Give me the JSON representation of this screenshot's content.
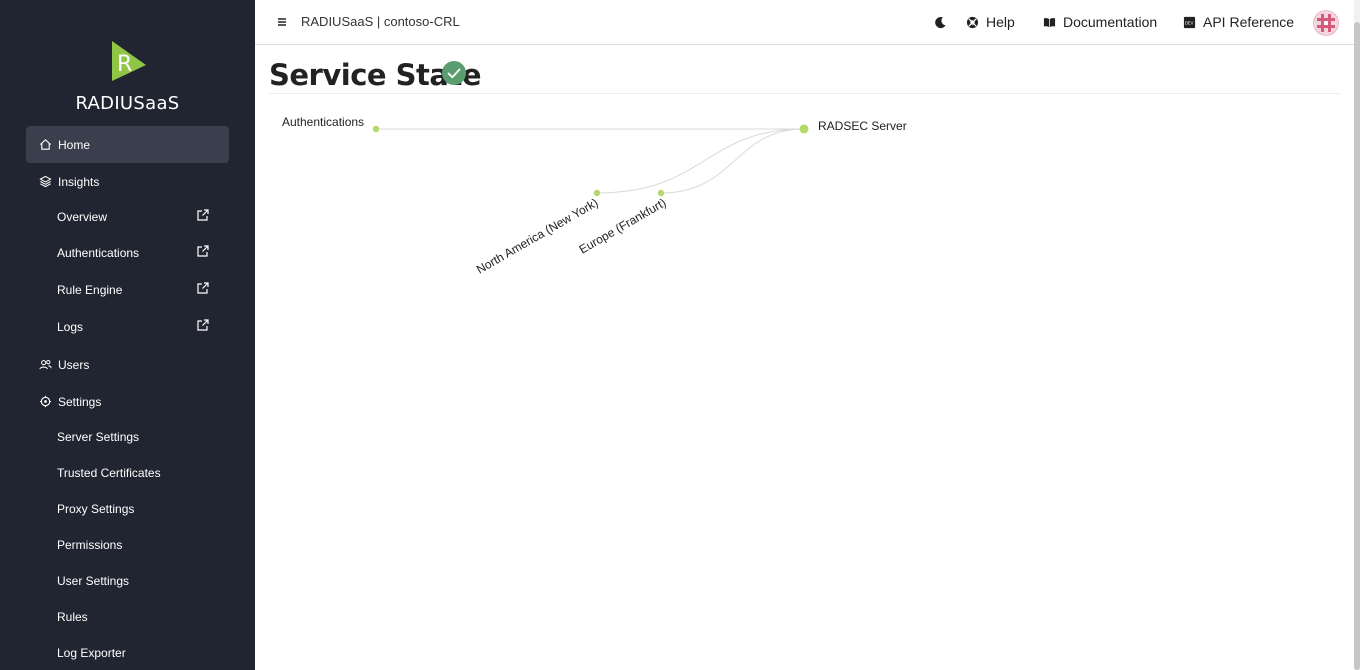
{
  "brand": {
    "name": "RADIUSaaS",
    "logo_letter": "R",
    "logo_color": "#8fc646"
  },
  "sidebar": {
    "home": {
      "label": "Home",
      "icon": "home-icon"
    },
    "insights": {
      "label": "Insights",
      "icon": "layers-icon",
      "items": [
        {
          "label": "Overview",
          "icon": "external-link-icon"
        },
        {
          "label": "Authentications",
          "icon": "external-link-icon"
        },
        {
          "label": "Rule Engine",
          "icon": "external-link-icon"
        },
        {
          "label": "Logs",
          "icon": "external-link-icon"
        }
      ]
    },
    "users": {
      "label": "Users",
      "icon": "users-icon"
    },
    "settings": {
      "label": "Settings",
      "icon": "gear-icon",
      "items": [
        {
          "label": "Server Settings"
        },
        {
          "label": "Trusted Certificates"
        },
        {
          "label": "Proxy Settings"
        },
        {
          "label": "Permissions"
        },
        {
          "label": "User Settings"
        },
        {
          "label": "Rules"
        },
        {
          "label": "Log Exporter"
        }
      ]
    }
  },
  "topbar": {
    "title": "RADIUSaaS | contoso-CRL",
    "help": "Help",
    "documentation": "Documentation",
    "api_reference": "API Reference",
    "api_icon_text": "DEV"
  },
  "main": {
    "title": "Service State",
    "status": "ok",
    "status_color": "#5a9e6f"
  },
  "graph": {
    "source": "Authentications",
    "target": "RADSEC Server",
    "regions": [
      "North America (New York)",
      "Europe (Frankfurt)"
    ],
    "node_color": "#b5d86c",
    "link_color": "#d9d9d9"
  }
}
